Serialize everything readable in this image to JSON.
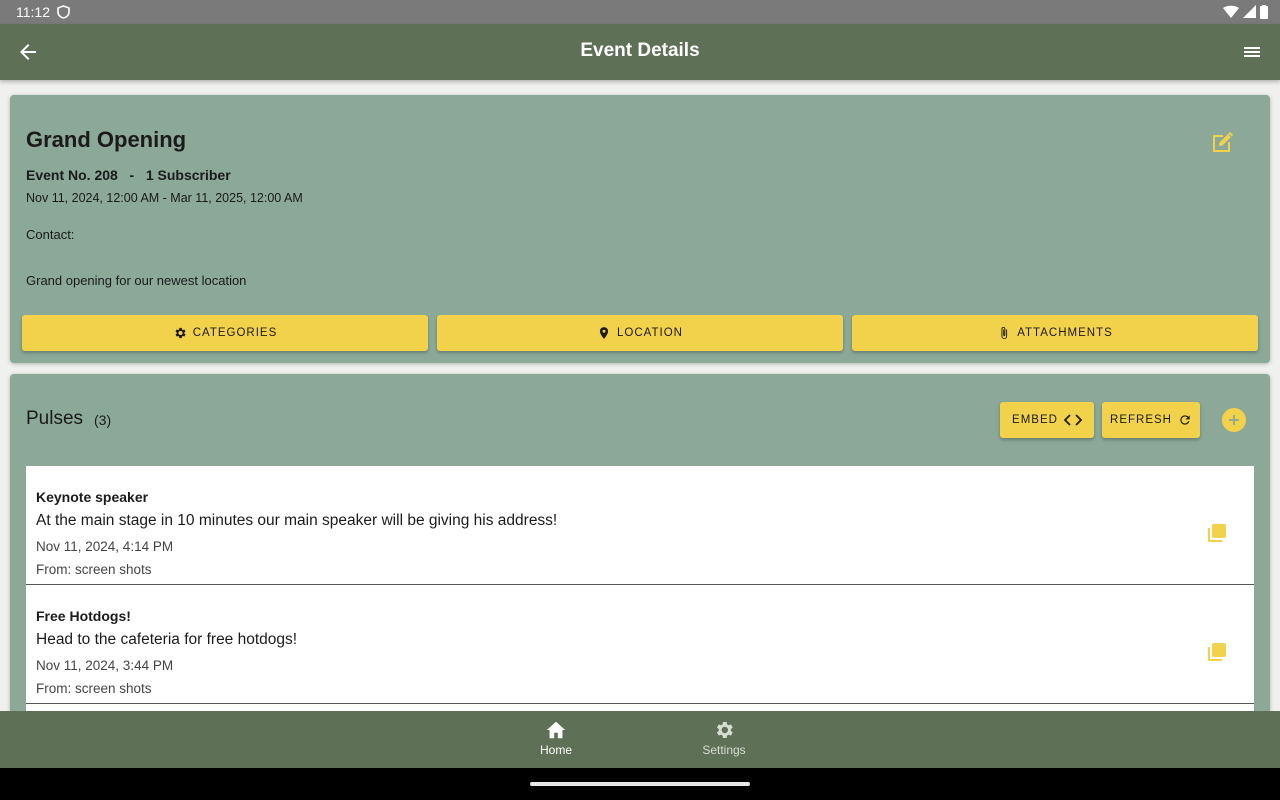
{
  "status_bar": {
    "time": "11:12"
  },
  "app_bar": {
    "title": "Event Details"
  },
  "event": {
    "title": "Grand Opening",
    "number": "Event No. 208",
    "separator": "-",
    "subscribers": "1 Subscriber",
    "dates": "Nov 11, 2024, 12:00 AM - Mar 11, 2025, 12:00 AM",
    "contact_label": "Contact:",
    "description": "Grand opening for our newest location",
    "actions": {
      "categories": "CATEGORIES",
      "location": "LOCATION",
      "attachments": "ATTACHMENTS"
    }
  },
  "pulses": {
    "title": "Pulses",
    "count": "(3)",
    "embed_label": "EMBED",
    "refresh_label": "REFRESH",
    "items": [
      {
        "name": "Keynote speaker",
        "body": "At the main stage in 10 minutes our main speaker will be giving his address!",
        "time": "Nov 11, 2024, 4:14 PM",
        "from": "From: screen shots"
      },
      {
        "name": "Free Hotdogs!",
        "body": "Head to the cafeteria for free hotdogs!",
        "time": "Nov 11, 2024, 3:44 PM",
        "from": "From: screen shots"
      }
    ]
  },
  "bottom_nav": {
    "home": "Home",
    "settings": "Settings"
  },
  "colors": {
    "app_bar": "#5e7055",
    "card": "#8ba898",
    "accent": "#f2d14b"
  }
}
